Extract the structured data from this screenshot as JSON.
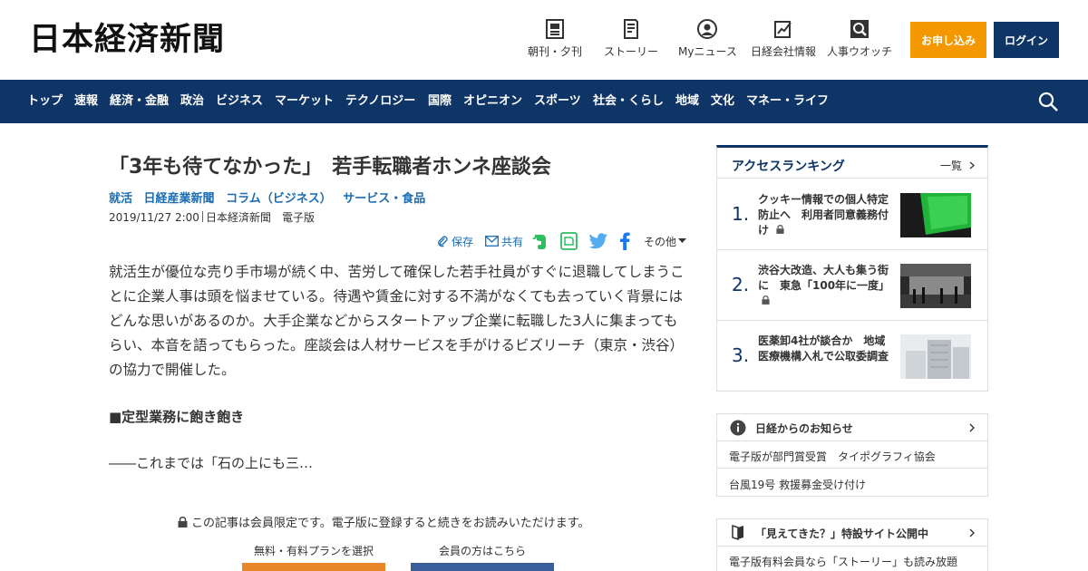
{
  "header": {
    "logo": "日本経済新聞",
    "nav": [
      {
        "label": "朝刊・夕刊",
        "icon": "newspaper-icon"
      },
      {
        "label": "ストーリー",
        "icon": "book-icon"
      },
      {
        "label": "Myニュース",
        "icon": "user-icon"
      },
      {
        "label": "日経会社情報",
        "icon": "chart-icon"
      },
      {
        "label": "人事ウオッチ",
        "icon": "search-person-icon"
      }
    ],
    "apply_label": "お申し込み",
    "login_label": "ログイン"
  },
  "navbar": {
    "items": [
      "トップ",
      "速報",
      "経済・金融",
      "政治",
      "ビジネス",
      "マーケット",
      "テクノロジー",
      "国際",
      "オピニオン",
      "スポーツ",
      "社会・くらし",
      "地域",
      "文化",
      "マネー・ライフ"
    ]
  },
  "article": {
    "title": "「3年も待てなかった」　若手転職者ホンネ座談会",
    "tags": [
      "就活",
      "日経産業新聞",
      "コラム（ビジネス）",
      "サービス・食品"
    ],
    "date": "2019/11/27 2:00",
    "source": "日本経済新聞　電子版",
    "share": {
      "save": "保存",
      "share": "共有",
      "other": "その他"
    },
    "body": "就活生が優位な売り手市場が続く中、苦労して確保した若手社員がすぐに退職してしまうことに企業人事は頭を悩ませている。待遇や賃金に対する不満がなくても去っていく背景にはどんな思いがあるのか。大手企業などからスタートアップ企業に転職した3人に集まってもらい、本音を語ってもらった。座談会は人材サービスを手がけるビズリーチ（東京・渋谷）の協力で開催した。",
    "subhead": "■定型業務に飽き飽き",
    "lead": "――これまでは「石の上にも三…",
    "lock_note": "この記事は会員限定です。電子版に登録すると続きをお読みいただけます。",
    "plan_label": "無料・有料プランを選択",
    "member_label": "会員の方はこちら"
  },
  "sidebar": {
    "ranking": {
      "title": "アクセスランキング",
      "more": "一覧",
      "items": [
        {
          "num": "1.",
          "text": "クッキー情報での個人特定防止へ　利用者同意義務付け"
        },
        {
          "num": "2.",
          "text": "渋谷大改造、大人も集う街に　東急「100年に一度」"
        },
        {
          "num": "3.",
          "text": "医薬卸4社が談合か　地域医療機構入札で公取委調査"
        }
      ]
    },
    "notice": {
      "title": "日経からのお知らせ",
      "items": [
        "電子版が部門賞受賞　タイポグラフィ協会",
        "台風19号 救援募金受け付け"
      ]
    },
    "story": {
      "title": "「見えてきた？」特設サイト公開中",
      "text": "電子版有料会員なら「ストーリー」も読み放題"
    }
  },
  "colors": {
    "navy": "#0f3466",
    "orange": "#f39800",
    "link": "#1a6db3"
  }
}
